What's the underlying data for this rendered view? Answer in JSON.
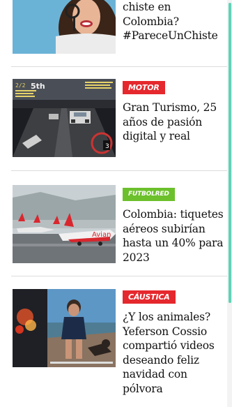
{
  "articles": [
    {
      "section": "",
      "headline": "chiste en Colombia? #PareceUnChiste",
      "image": "woman-smiling-portrait"
    },
    {
      "section": "MOTOR",
      "headline": "Gran Turismo, 25 años de pasión digital y real",
      "image": "racing-game-screenshot"
    },
    {
      "section": "FUTBOLRED",
      "headline": "Colombia: tiquetes aéreos subirían hasta un 40% para 2023",
      "image": "airplanes-on-tarmac",
      "image_text": "Avian"
    },
    {
      "section": "CÁUSTICA",
      "headline": "¿Y los animales? Yeferson Cossio compartió videos deseando feliz navidad con pólvora",
      "image": "man-with-dog-at-beach"
    }
  ],
  "game_hud": {
    "left_top": "2/2",
    "rank": "5th",
    "gear": "3"
  },
  "colors": {
    "badge_red": "#e5282d",
    "badge_green": "#6cc02b",
    "scroll_accent": "#5fd3b7"
  }
}
